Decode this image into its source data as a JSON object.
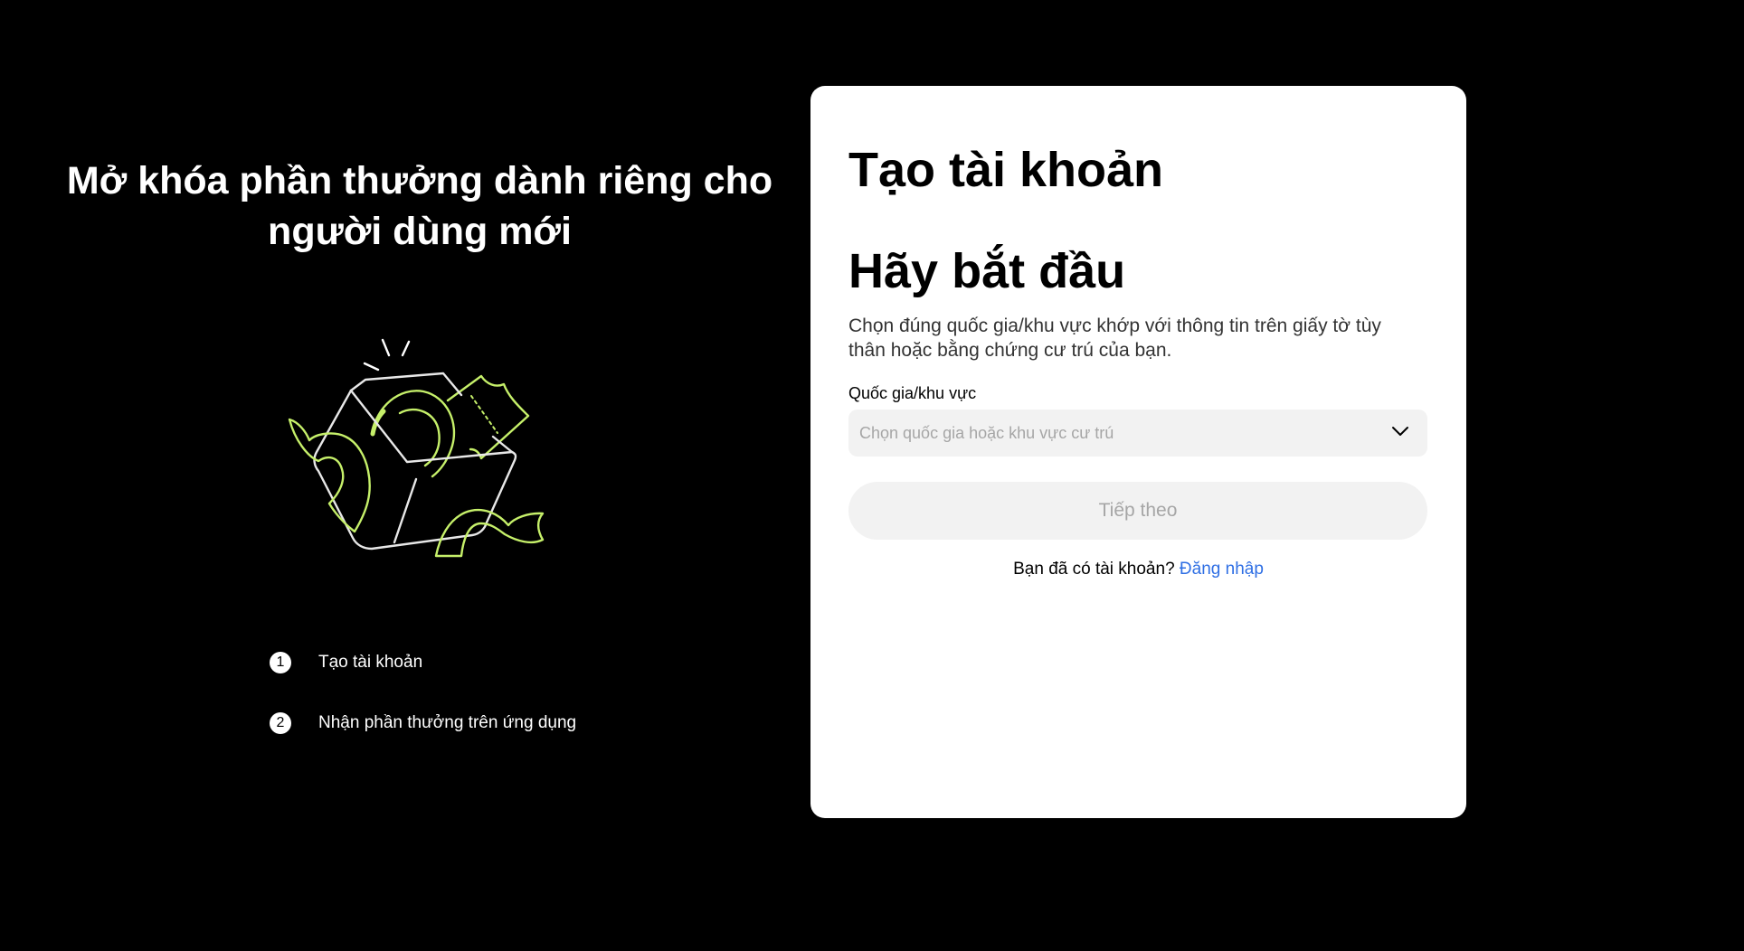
{
  "promo": {
    "title": "Mở khóa phần thưởng dành riêng cho người dùng mới",
    "illustration": "gift-box-icon",
    "steps": [
      {
        "number": "1",
        "label": "Tạo tài khoản"
      },
      {
        "number": "2",
        "label": "Nhận phần thưởng trên ứng dụng"
      }
    ]
  },
  "form": {
    "title": "Tạo tài khoản",
    "subtitle": "Hãy bắt đầu",
    "description": "Chọn đúng quốc gia/khu vực khớp với thông tin trên giấy tờ tùy thân hoặc bằng chứng cư trú của bạn.",
    "country_label": "Quốc gia/khu vực",
    "country_placeholder": "Chọn quốc gia hoặc khu vực cư trú",
    "next_label": "Tiếp theo",
    "login_prompt": "Bạn đã có tài khoản?",
    "login_link": "Đăng nhập"
  },
  "colors": {
    "background": "#000000",
    "card": "#ffffff",
    "accent_green": "#c6f06a",
    "link_blue": "#2f6fe4",
    "disabled_bg": "#f2f2f2",
    "disabled_text": "#a6a6a6"
  }
}
